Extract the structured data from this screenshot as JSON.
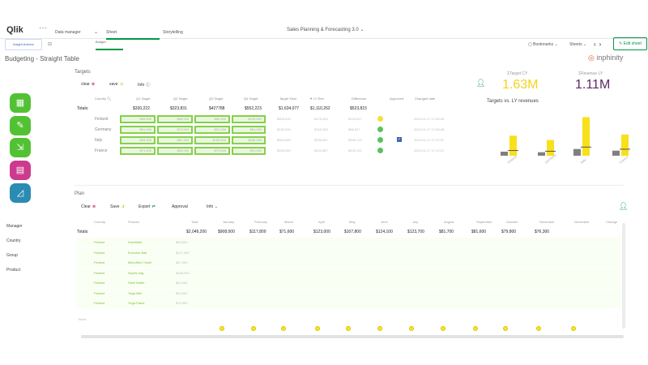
{
  "header": {
    "logo": "Qlik",
    "logo_q": "Q",
    "menu_dots": "···",
    "dropdown1_value": "Data manager",
    "dropdown2_value": "Sheet",
    "dropdown3_value": "Storytelling",
    "app_title": "Sales Planning & Forecasting 3.0",
    "bookmarks": "Bookmarks",
    "sheets": "Sheets",
    "edit_sheet": "Edit sheet",
    "insight_advisor": "Insight Advisor",
    "budget_tab": "Budget"
  },
  "sheet": {
    "title": "Budgeting - Straight Table",
    "brand": "inphinity",
    "brand_o": "O"
  },
  "sidebar": {
    "filters": [
      "Manager",
      "Country",
      "Group",
      "Product"
    ]
  },
  "targets": {
    "title": "Targets",
    "clear_label": "clear",
    "save_label": "save",
    "info_label": "Info",
    "headers": [
      "Country",
      "Q1 Target",
      "Q2 Target",
      "Q3 Target",
      "Q4 Target",
      "Target Total",
      "LY Rev.",
      "Difference",
      "Approved",
      "Changed date"
    ],
    "totals_label": "Totals:",
    "totals": [
      "$330,222",
      "$323,831",
      "$427788",
      "$552,223",
      "$1,634,077",
      "$1,110,262",
      "$523,815"
    ],
    "rows": [
      {
        "country": "Finland",
        "q1": "$60,000",
        "q2": "$68,000",
        "q3": "$80,000",
        "q4": "$100,000",
        "total": "$308,000",
        "ly": "$178,383",
        "diff": "$129,617",
        "date": "2024-01-17 17:08:26"
      },
      {
        "country": "Germany",
        "q1": "$51,000",
        "q2": "$73,000",
        "q3": "$57,000",
        "q4": "$61,000",
        "total": "$242,000",
        "ly": "$153,453",
        "diff": "$88,547",
        "date": "2024-01-17 17:08:48"
      },
      {
        "country": "Italy",
        "q1": "$83,333",
        "q2": "$82,333",
        "q3": "$160,000",
        "q4": "$268,000",
        "total": "$593,666",
        "ly": "$295,487",
        "diff": "$298,179",
        "date": "2024-01-17 17:10:37"
      },
      {
        "country": "France",
        "q1": "$71,000",
        "q2": "$85,000",
        "q3": "$79,000",
        "q4": "$91,000",
        "total": "$326,000",
        "ly": "$222,887",
        "diff": "$103,113",
        "date": "2024-01-17 17:10:21"
      }
    ],
    "status_colors": [
      "#f2df3a",
      "#5cc15c",
      "#5cc15c",
      "#5cc15c"
    ]
  },
  "kpis": [
    {
      "label": "ΣTarget CY",
      "value": "1.63M",
      "color": "#f5d21d"
    },
    {
      "label": "ΣRevenue LY",
      "value": "1.11M",
      "color": "#5b2b66"
    }
  ],
  "chart_data": {
    "type": "bar",
    "title": "Targets vs. LY revenues",
    "categories": [
      "Finland",
      "Germany",
      "Italy",
      "France"
    ],
    "series": [],
    "values_ly": [
      178383,
      153453,
      295487,
      222887
    ],
    "values_target": [
      308000,
      242000,
      593666,
      326000
    ],
    "colors": {
      "ly": "#7f7f7f",
      "target": "#f8e01c"
    }
  },
  "plan": {
    "title": "Plan",
    "clear_label": "Clear",
    "save_label": "Save",
    "export_label": "Export",
    "approval_label": "Approval",
    "info_label": "Info",
    "headers": [
      "Country",
      "Product",
      "Total",
      "January",
      "February",
      "March",
      "April",
      "May",
      "June",
      "July",
      "August",
      "September",
      "October",
      "November",
      "December",
      "Change"
    ],
    "totals_label": "Totals:",
    "totals": [
      "$2,049,200",
      "$908,000",
      "$117,800",
      "$71,600",
      "$123,000",
      "$107,800",
      "$124,100",
      "$123,700",
      "$81,700",
      "$81,600",
      "$79,800",
      "$76,300"
    ],
    "rows": [
      {
        "country": "Finland",
        "product": "Dumbbell",
        "total": "$65,600"
      },
      {
        "country": "Finland",
        "product": "Exercise Ball",
        "total": "$117,000"
      },
      {
        "country": "Finland",
        "product": "Microfibre Towel",
        "total": "$47,000"
      },
      {
        "country": "Finland",
        "product": "Sports bag",
        "total": "$108,000"
      },
      {
        "country": "Finland",
        "product": "Steel Bottle",
        "total": "$49,200"
      },
      {
        "country": "Finland",
        "product": "Yoga Mat",
        "total": "$40,000"
      },
      {
        "country": "Finland",
        "product": "Yoga Pants",
        "total": "$70,000"
      }
    ],
    "footer_label": "Totals"
  }
}
